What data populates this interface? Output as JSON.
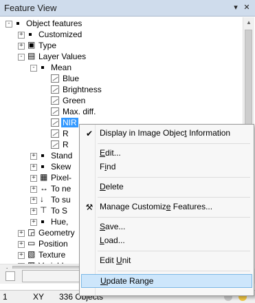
{
  "window": {
    "title": "Feature View",
    "pin_glyph": "▾",
    "close_glyph": "✕"
  },
  "tree": [
    {
      "label": "Object features",
      "exp": "-",
      "icon": "square",
      "depth": 0
    },
    {
      "label": "Customized",
      "exp": "+",
      "icon": "square",
      "depth": 1
    },
    {
      "label": "Type",
      "exp": "+",
      "icon": "type-icon",
      "depth": 1
    },
    {
      "label": "Layer Values",
      "exp": "-",
      "icon": "layer-values-icon",
      "depth": 1
    },
    {
      "label": "Mean",
      "exp": "-",
      "icon": "square",
      "depth": 2
    },
    {
      "label": "Blue",
      "exp": "",
      "icon": "leaf",
      "depth": 3
    },
    {
      "label": "Brightness",
      "exp": "",
      "icon": "leaf",
      "depth": 3
    },
    {
      "label": "Green",
      "exp": "",
      "icon": "leaf",
      "depth": 3
    },
    {
      "label": "Max. diff.",
      "exp": "",
      "icon": "leaf",
      "depth": 3
    },
    {
      "label": "NIR",
      "exp": "",
      "icon": "leaf",
      "depth": 3,
      "selected": true
    },
    {
      "label": "R",
      "exp": "",
      "icon": "leaf",
      "depth": 3
    },
    {
      "label": "R",
      "exp": "",
      "icon": "leaf",
      "depth": 3
    },
    {
      "label": "Stand",
      "exp": "+",
      "icon": "square",
      "depth": 2
    },
    {
      "label": "Skew",
      "exp": "+",
      "icon": "square",
      "depth": 2
    },
    {
      "label": "Pixel-",
      "exp": "+",
      "icon": "pixel-grid-icon",
      "depth": 2
    },
    {
      "label": "To ne",
      "exp": "+",
      "icon": "neighbor-arrow-icon",
      "depth": 2
    },
    {
      "label": "To su",
      "exp": "+",
      "icon": "sub-object-icon",
      "depth": 2
    },
    {
      "label": "To S",
      "exp": "+",
      "icon": "super-object-icon",
      "depth": 2
    },
    {
      "label": "Hue,",
      "exp": "+",
      "icon": "square",
      "depth": 2
    },
    {
      "label": "Geometry",
      "exp": "+",
      "icon": "geometry-icon",
      "depth": 1
    },
    {
      "label": "Position",
      "exp": "+",
      "icon": "position-icon",
      "depth": 1
    },
    {
      "label": "Texture",
      "exp": "+",
      "icon": "texture-icon",
      "depth": 1
    },
    {
      "label": "Variable",
      "exp": "+",
      "icon": "variable-icon",
      "depth": 1
    }
  ],
  "context_menu": {
    "items": [
      {
        "label": "Display in Image Object Information",
        "icon": "checkmark-icon",
        "glyph": "✔",
        "hover": false
      },
      {
        "sep": true
      },
      {
        "label": "Edit...",
        "icon": "",
        "glyph": "",
        "hover": false
      },
      {
        "label": "Find",
        "icon": "",
        "glyph": "",
        "hover": false
      },
      {
        "sep": true
      },
      {
        "label": "Delete",
        "icon": "",
        "glyph": "",
        "hover": false
      },
      {
        "sep": true
      },
      {
        "label": "Manage Customize Features...",
        "icon": "tools-icon",
        "glyph": "⚒",
        "hover": false
      },
      {
        "sep": true
      },
      {
        "label": "Save...",
        "icon": "",
        "glyph": "",
        "hover": false
      },
      {
        "label": "Load...",
        "icon": "",
        "glyph": "",
        "hover": false
      },
      {
        "sep": true
      },
      {
        "label": "Edit Unit",
        "icon": "",
        "glyph": "",
        "hover": false
      },
      {
        "sep": true
      },
      {
        "label": "Update Range",
        "icon": "",
        "glyph": "",
        "hover": true
      }
    ]
  },
  "status": {
    "level": "1",
    "unit": "XY",
    "objects": "336 Objects"
  },
  "colors": {
    "titlebar": "#cfdcec",
    "selection": "#3399ff",
    "menu_hover": "#cde6fb"
  }
}
